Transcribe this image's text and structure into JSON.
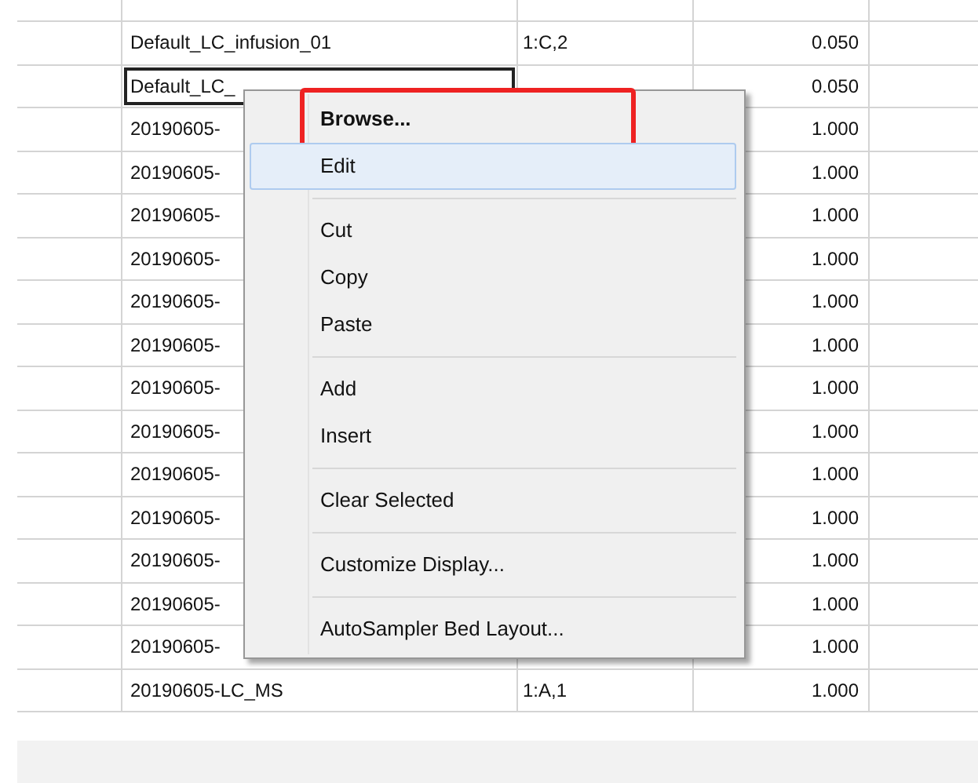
{
  "table": {
    "rows": [
      {
        "name": "Default_LC_infusion_01",
        "position": "1:C,2",
        "value": "0.050",
        "selected": false
      },
      {
        "name": "Default_LC_",
        "position": "",
        "value": "0.050",
        "selected": true
      },
      {
        "name": "20190605-",
        "position": "",
        "value": "1.000",
        "selected": false
      },
      {
        "name": "20190605-",
        "position": "",
        "value": "1.000",
        "selected": false
      },
      {
        "name": "20190605-",
        "position": "",
        "value": "1.000",
        "selected": false
      },
      {
        "name": "20190605-",
        "position": "",
        "value": "1.000",
        "selected": false
      },
      {
        "name": "20190605-",
        "position": "",
        "value": "1.000",
        "selected": false
      },
      {
        "name": "20190605-",
        "position": "",
        "value": "1.000",
        "selected": false
      },
      {
        "name": "20190605-",
        "position": "",
        "value": "1.000",
        "selected": false
      },
      {
        "name": "20190605-",
        "position": "",
        "value": "1.000",
        "selected": false
      },
      {
        "name": "20190605-",
        "position": "",
        "value": "1.000",
        "selected": false
      },
      {
        "name": "20190605-",
        "position": "",
        "value": "1.000",
        "selected": false
      },
      {
        "name": "20190605-",
        "position": "",
        "value": "1.000",
        "selected": false
      },
      {
        "name": "20190605-",
        "position": "",
        "value": "1.000",
        "selected": false
      },
      {
        "name": "20190605-",
        "position": "",
        "value": "1.000",
        "selected": false
      },
      {
        "name": "20190605-LC_MS",
        "position": "1:A,1",
        "value": "1.000",
        "selected": false
      }
    ]
  },
  "context_menu": {
    "items": [
      {
        "kind": "item",
        "label": "Browse...",
        "bold": true,
        "highlighted": false,
        "framed": true
      },
      {
        "kind": "item",
        "label": "Edit",
        "bold": false,
        "highlighted": true,
        "framed": false
      },
      {
        "kind": "separator"
      },
      {
        "kind": "item",
        "label": "Cut",
        "bold": false,
        "highlighted": false,
        "framed": false
      },
      {
        "kind": "item",
        "label": "Copy",
        "bold": false,
        "highlighted": false,
        "framed": false
      },
      {
        "kind": "item",
        "label": "Paste",
        "bold": false,
        "highlighted": false,
        "framed": false
      },
      {
        "kind": "separator"
      },
      {
        "kind": "item",
        "label": "Add",
        "bold": false,
        "highlighted": false,
        "framed": false
      },
      {
        "kind": "item",
        "label": "Insert",
        "bold": false,
        "highlighted": false,
        "framed": false
      },
      {
        "kind": "separator"
      },
      {
        "kind": "item",
        "label": "Clear Selected",
        "bold": false,
        "highlighted": false,
        "framed": false
      },
      {
        "kind": "separator"
      },
      {
        "kind": "item",
        "label": "Customize Display...",
        "bold": false,
        "highlighted": false,
        "framed": false
      },
      {
        "kind": "separator"
      },
      {
        "kind": "item",
        "label": "AutoSampler Bed Layout...",
        "bold": false,
        "highlighted": false,
        "framed": false
      }
    ]
  }
}
